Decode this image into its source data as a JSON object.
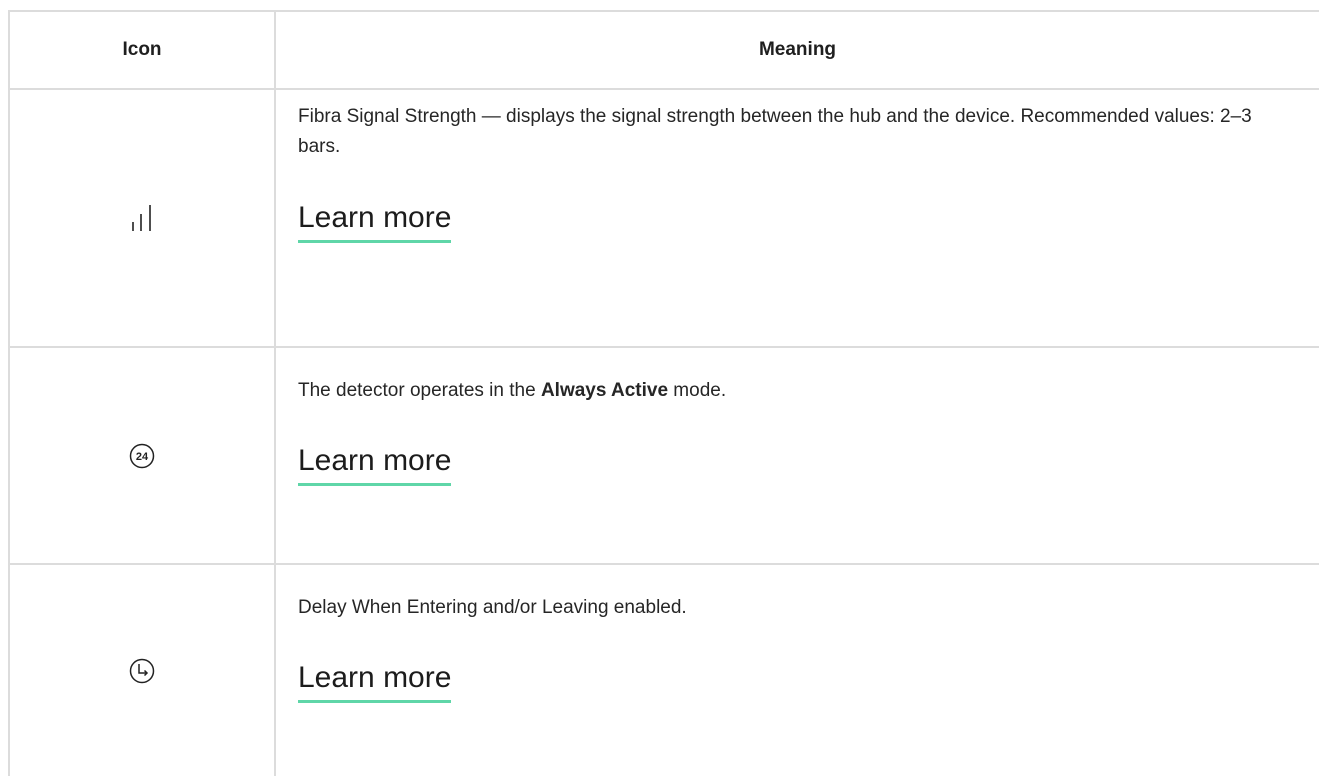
{
  "header": {
    "icon_col": "Icon",
    "meaning_col": "Meaning"
  },
  "rows": [
    {
      "icon": "signal-strength-icon",
      "description": "Fibra Signal Strength — displays the signal strength between the hub and the device. Recommended values: 2–3 bars.",
      "link": "Learn more"
    },
    {
      "icon": "always-active-24-icon",
      "icon_text": "24",
      "description_before": "The detector operates in the ",
      "description_bold": "Always Active",
      "description_after": " mode.",
      "link": "Learn more"
    },
    {
      "icon": "delay-clock-icon",
      "description": "Delay When Entering and/or Leaving enabled.",
      "link": "Learn more"
    }
  ],
  "colors": {
    "border": "#dcdcdc",
    "link_underline": "#5fd6a8",
    "text": "#262626"
  }
}
